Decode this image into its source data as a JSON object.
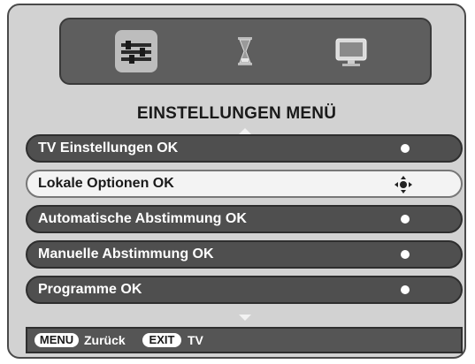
{
  "top_icons": [
    {
      "icon": "settings-sliders-icon",
      "selected": true
    },
    {
      "icon": "hourglass-icon",
      "selected": false
    },
    {
      "icon": "monitor-icon",
      "selected": false
    }
  ],
  "title": "EINSTELLUNGEN MENÜ",
  "menu": {
    "items": [
      {
        "label": "TV Einstellungen OK",
        "selected": false
      },
      {
        "label": "Lokale Optionen OK",
        "selected": true
      },
      {
        "label": "Automatische Abstimmung OK",
        "selected": false
      },
      {
        "label": "Manuelle Abstimmung OK",
        "selected": false
      },
      {
        "label": "Programme OK",
        "selected": false
      }
    ]
  },
  "footer": {
    "menu_key": "MENU",
    "menu_action": "Zurück",
    "exit_key": "EXIT",
    "exit_action": "TV"
  },
  "colors": {
    "frame_bg": "#d2d2d2",
    "item_bg": "#4f4f4f",
    "selected_bg": "#f3f3f3"
  }
}
